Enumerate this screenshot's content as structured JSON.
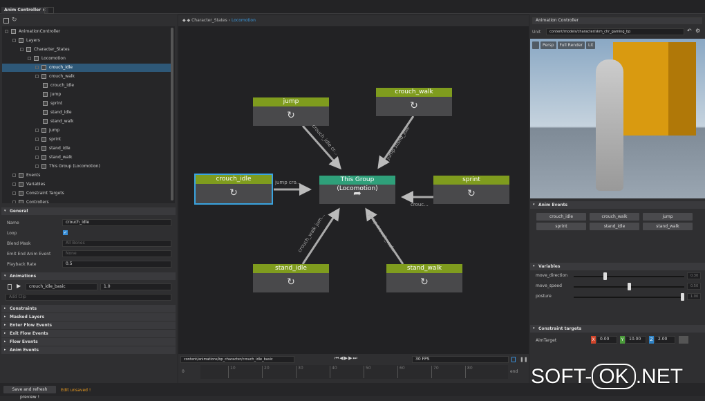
{
  "window": {
    "tab": "Anim Controller",
    "tab_close": "×"
  },
  "tree": {
    "items": [
      {
        "label": "AnimationController",
        "depth": 0
      },
      {
        "label": "Layers",
        "depth": 1
      },
      {
        "label": "Character_States",
        "depth": 2
      },
      {
        "label": "Locomotion",
        "depth": 3
      },
      {
        "label": "crouch_idle",
        "depth": 4,
        "selected": true
      },
      {
        "label": "crouch_walk",
        "depth": 4
      },
      {
        "label": "crouch_idle",
        "depth": 5
      },
      {
        "label": "jump",
        "depth": 5
      },
      {
        "label": "sprint",
        "depth": 5
      },
      {
        "label": "stand_idle",
        "depth": 5
      },
      {
        "label": "stand_walk",
        "depth": 5
      },
      {
        "label": "jump",
        "depth": 4
      },
      {
        "label": "sprint",
        "depth": 4
      },
      {
        "label": "stand_idle",
        "depth": 4
      },
      {
        "label": "stand_walk",
        "depth": 4
      },
      {
        "label": "This Group (Locomotion)",
        "depth": 4
      },
      {
        "label": "Events",
        "depth": 1
      },
      {
        "label": "Variables",
        "depth": 1
      },
      {
        "label": "Constraint Targets",
        "depth": 1
      },
      {
        "label": "Controllers",
        "depth": 1
      }
    ]
  },
  "general": {
    "title": "General",
    "name_label": "Name",
    "name_value": "crouch_idle",
    "loop_label": "Loop",
    "loop_checked": true,
    "blend_label": "Blend Mask",
    "blend_placeholder": "All Bones",
    "emit_label": "Emit End Anim Event",
    "emit_placeholder": "None",
    "rate_label": "Playback Rate",
    "rate_value": "0.5"
  },
  "animations": {
    "title": "Animations",
    "clip": "crouch_idle_basic",
    "weight": "1.0",
    "add_placeholder": "Add Clip"
  },
  "collapsed_sections": [
    "Constraints",
    "Masked Layers",
    "Enter Flow Events",
    "Exit Flow Events",
    "Flow Events",
    "Anim Events"
  ],
  "footer": {
    "save_button": "Save and refresh preview !",
    "unsaved": "Edit unsaved !"
  },
  "breadcrumb": {
    "parent": "Character_States",
    "sep": "›",
    "current": "Locomotion"
  },
  "graph": {
    "nodes": {
      "jump": "jump",
      "crouch_walk": "crouch_walk",
      "crouch_idle": "crouch_idle",
      "group": "This Group (Locomotion)",
      "sprint": "sprint",
      "stand_idle": "stand_idle",
      "stand_walk": "stand_walk"
    },
    "edges": {
      "crouch_idle": "jump  cro...",
      "jump": "crouch_idle  cr...",
      "crouch_walk": "jump  stand_idle",
      "sprint": "crouc...",
      "stand_idle": "crouch_walk  jum...",
      "stand_walk": "jump  crouch_wal..."
    }
  },
  "timeline": {
    "clip_path": "content/animations/bp_character/crouch_idle_basic",
    "fps": "30 FPS",
    "start": "0",
    "end": "end",
    "ticks": [
      "10",
      "20",
      "30",
      "40",
      "50",
      "60",
      "70",
      "80"
    ]
  },
  "right": {
    "title": "Animation Controller",
    "unit_label": "Unit",
    "unit_value": "content/models/character/skm_chr_gaming_bp",
    "viewport_buttons": [
      "Persp",
      "Full Render",
      "Lit"
    ],
    "anim_events": {
      "title": "Anim Events",
      "buttons": [
        "crouch_idle",
        "crouch_walk",
        "jump",
        "sprint",
        "stand_idle",
        "stand_walk"
      ]
    },
    "variables": {
      "title": "Variables",
      "items": [
        {
          "name": "move_direction",
          "value": "0.30",
          "fraction": 0.28
        },
        {
          "name": "move_speed",
          "value": "0.50",
          "fraction": 0.5
        },
        {
          "name": "posture",
          "value": "1.00",
          "fraction": 1.0
        }
      ]
    },
    "constraints": {
      "title": "Constraint targets",
      "name": "AimTarget",
      "x_label": "X",
      "x": "0.00",
      "y_label": "Y",
      "y": "10.00",
      "z_label": "Z",
      "z": "2.00"
    }
  },
  "watermark": "SOFT-OK.NET",
  "colors": {
    "node_header": "#7f9c1e",
    "group_header": "#2fa07a",
    "selection": "#3aa4e0"
  }
}
